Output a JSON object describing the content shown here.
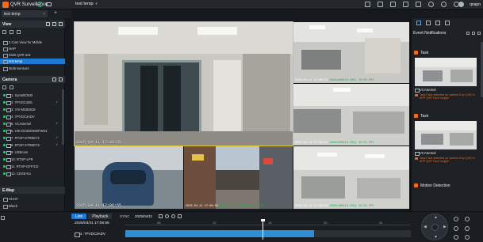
{
  "app": {
    "title": "QVR Surveillance",
    "view_name": "test temp",
    "user": "qnapn"
  },
  "tabs": {
    "active": "test temp"
  },
  "left_panel": {
    "view_header": "View",
    "views": [
      {
        "label": "2 Cam View for Mobile"
      },
      {
        "label": "MAP"
      },
      {
        "label": "0325 QVR test"
      },
      {
        "label": "test temp",
        "selected": true
      },
      {
        "label": "Multi-Sensors"
      }
    ],
    "camera_header": "Camera",
    "cameras": [
      {
        "label": "1. SynoBC500"
      },
      {
        "label": "2. TPVDC4BS"
      },
      {
        "label": "3. VIV-MS8391E"
      },
      {
        "label": "4. TPVDC3ADV"
      },
      {
        "label": "5. VCASemel"
      },
      {
        "label": "6. HIK-DS2DE655FWD1"
      },
      {
        "label": "7. RTSP-STREET1"
      },
      {
        "label": "8. RTSP-STREET2"
      },
      {
        "label": "9. USBcam"
      },
      {
        "label": "10. RTSP-LPR"
      },
      {
        "label": "11. RTSP-OFFICE"
      },
      {
        "label": "12. CDS5-Ka"
      }
    ],
    "emap_header": "E-Map",
    "emap_items": [
      {
        "label": "XHAF"
      },
      {
        "label": "Black"
      }
    ]
  },
  "grid": {
    "tiles": [
      {
        "osd": "2025-04-11 17:06:55",
        "sub": ""
      },
      {
        "osd": "2025-04-11 17:06:55",
        "sub": "1920x1080(H.264) 25/25 FPS"
      },
      {
        "osd": "2025-04-11 17:06:55",
        "sub": "1920x1080(H.264) 25/25 FPS"
      },
      {
        "osd": "2025-04-11 17:06:55",
        "sub": "1920x1080(H.264) 25/30 FPS"
      },
      {
        "osd": "2025-04-11 17:06:55",
        "sub": "1920x1080(H.264) 25/25 FPS"
      },
      {
        "osd": "2025-04-11 17:06:55",
        "sub": "1920x1080(H.265) 25/30 FPS"
      },
      {
        "osd": "2025-04-11 17:06:55",
        "sub": "1920x1080(H.264) 25/25 FPS"
      }
    ]
  },
  "right_panel": {
    "title": "Event Notifications",
    "events": [
      {
        "type": "Task",
        "source": "VCASemel",
        "desc": "Task Face detected on camera 5 by QVR in APP QVR Face Insight"
      },
      {
        "type": "Task",
        "source": "VCASemel",
        "desc": "Task Face detected on camera 5 by QVR in APP QVR Face Insight"
      },
      {
        "type": "Motion Detection",
        "source": "",
        "desc": ""
      }
    ]
  },
  "timeline": {
    "live_label": "Live",
    "playback_label": "Playback",
    "sync_label": "SYNC",
    "date": "2025/04/11",
    "current_time": "2025/04/11 17:06:55",
    "ruler_labels": [
      "08",
      "12",
      "16",
      "20",
      "24"
    ],
    "track_camera": "4. TPVDC3ADV",
    "recorded_fraction": 0.66,
    "cursor_fraction": 0.48
  },
  "colors": {
    "accent": "#f26b1d",
    "selection": "#1f7ad6",
    "active_tile": "#e3c53a",
    "recording": "#2f8fd6"
  }
}
